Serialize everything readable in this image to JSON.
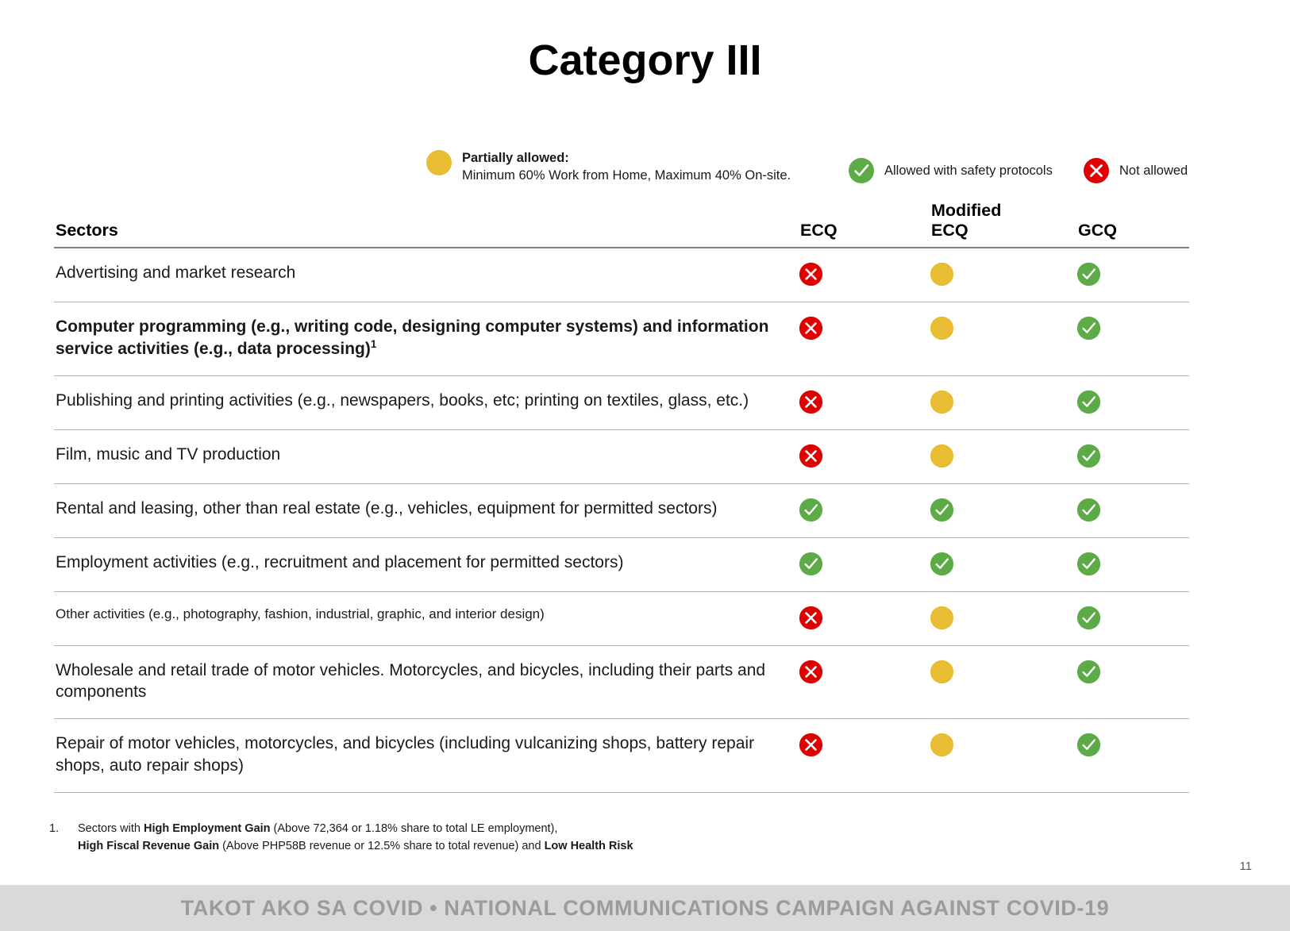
{
  "slide": {
    "title": "Category III",
    "page_number": "11"
  },
  "legend": {
    "partial": {
      "icon": "yellow-circle-icon",
      "title": "Partially allowed:",
      "subtitle": "Minimum 60% Work from Home,  Maximum 40% On-site.",
      "color": "#e8bd34"
    },
    "allowed": {
      "icon": "green-check-circle-icon",
      "label": "Allowed with safety protocols",
      "color": "#58a843"
    },
    "not_allowed": {
      "icon": "red-x-circle-icon",
      "label": "Not allowed",
      "color": "#e00000"
    }
  },
  "table": {
    "headers": {
      "sector": "Sectors",
      "ecq": "ECQ",
      "mecq_line1": "Modified",
      "mecq_line2": "ECQ",
      "gcq": "GCQ"
    },
    "rows": [
      {
        "sector": "Advertising and market research",
        "style": "normal",
        "ecq": "not-allowed",
        "mecq": "partial",
        "gcq": "allowed"
      },
      {
        "sector": "Computer programming (e.g., writing code, designing computer systems)  and information service activities (e.g., data processing)",
        "footnote_marker": "1",
        "style": "bold",
        "ecq": "not-allowed",
        "mecq": "partial",
        "gcq": "allowed"
      },
      {
        "sector": "Publishing and printing activities (e.g., newspapers, books, etc; printing on textiles, glass, etc.)",
        "style": "normal",
        "ecq": "not-allowed",
        "mecq": "partial",
        "gcq": "allowed"
      },
      {
        "sector": "Film, music and TV production",
        "style": "normal",
        "ecq": "not-allowed",
        "mecq": "partial",
        "gcq": "allowed"
      },
      {
        "sector": "Rental and leasing, other than real estate (e.g., vehicles, equipment for permitted sectors)",
        "style": "normal",
        "ecq": "allowed",
        "mecq": "allowed",
        "gcq": "allowed"
      },
      {
        "sector": "Employment activities (e.g., recruitment and placement for permitted sectors)",
        "style": "normal",
        "ecq": "allowed",
        "mecq": "allowed",
        "gcq": "allowed"
      },
      {
        "sector": "Other activities (e.g., photography, fashion, industrial, graphic, and interior design)",
        "style": "small",
        "ecq": "not-allowed",
        "mecq": "partial",
        "gcq": "allowed"
      },
      {
        "sector": "Wholesale and retail trade of motor vehicles. Motorcycles, and bicycles, including their parts and components",
        "style": "normal",
        "ecq": "not-allowed",
        "mecq": "partial",
        "gcq": "allowed"
      },
      {
        "sector": "Repair of motor vehicles, motorcycles, and bicycles (including vulcanizing shops, battery repair shops, auto repair shops)",
        "style": "normal",
        "ecq": "not-allowed",
        "mecq": "partial",
        "gcq": "allowed"
      }
    ]
  },
  "footnote": {
    "number": "1.",
    "line1_pre": "Sectors with ",
    "line1_bold": "High Employment Gain",
    "line1_post": " (Above 72,364 or 1.18% share to total LE employment),",
    "line2_bold1": "High Fiscal Revenue Gain",
    "line2_mid": " (Above PHP58B revenue or 12.5% share to total revenue) and ",
    "line2_bold2": "Low Health Risk"
  },
  "banner": {
    "text": "TAKOT AKO SA COVID • NATIONAL COMMUNICATIONS CAMPAIGN AGAINST COVID-19"
  }
}
